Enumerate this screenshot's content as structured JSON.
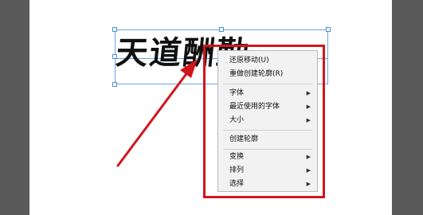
{
  "canvas": {
    "calligraphy_text": "天道酬勤"
  },
  "context_menu": {
    "items": [
      {
        "label": "还原移动(U)",
        "submenu": false
      },
      {
        "label": "重做创建轮廓(R)",
        "submenu": false
      },
      {
        "label": "字体",
        "submenu": true
      },
      {
        "label": "最近使用的字体",
        "submenu": true
      },
      {
        "label": "大小",
        "submenu": true
      },
      {
        "label": "创建轮廓",
        "submenu": false
      },
      {
        "label": "变换",
        "submenu": true
      },
      {
        "label": "排列",
        "submenu": true
      },
      {
        "label": "选择",
        "submenu": true
      }
    ]
  },
  "annotation": {
    "color": "#d0161b"
  }
}
